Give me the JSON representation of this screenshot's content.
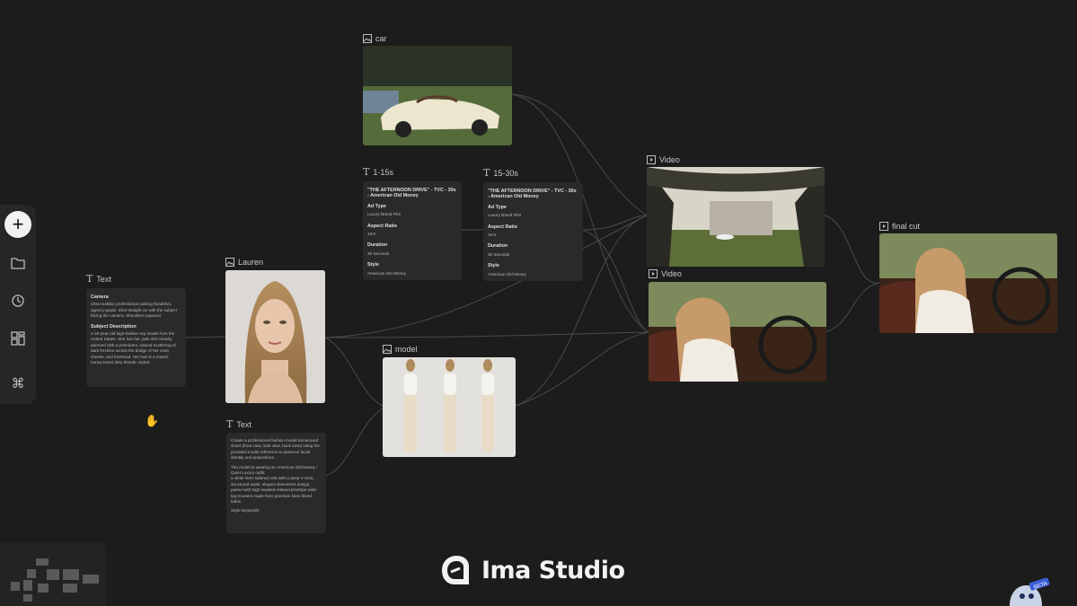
{
  "brand": {
    "name": "Ima Studio"
  },
  "toolbar": {
    "items": [
      {
        "name": "add",
        "icon": "plus-icon"
      },
      {
        "name": "files",
        "icon": "folder-icon"
      },
      {
        "name": "history",
        "icon": "history-icon"
      },
      {
        "name": "templates",
        "icon": "grid-icon"
      },
      {
        "name": "shortcuts",
        "icon": "command-icon"
      }
    ]
  },
  "nodes": {
    "car": {
      "label": "car",
      "icon": "image-icon"
    },
    "lauren": {
      "label": "Lauren",
      "icon": "image-icon"
    },
    "model": {
      "label": "model",
      "icon": "image-icon"
    },
    "video1": {
      "label": "Video",
      "icon": "video-icon"
    },
    "video2": {
      "label": "Video",
      "icon": "video-icon"
    },
    "final": {
      "label": "final cut",
      "icon": "video-icon"
    },
    "text1": {
      "label": "Text",
      "h1": "Camera",
      "p1": "Ultra-realistic professional casting headshot, agency-grade. Shot straight-on with the subject facing the camera. Shoulders squared.",
      "h2": "Subject Description",
      "p2": "A 20-year-old high-fashion top model from the United States. She has fair, pale skin heavily adorned with a prominent, natural scattering of dark freckles across the bridge of her nose, cheeks, and forehead. Her hair is a muted, honey-toned dirty blonde, styled"
    },
    "text2": {
      "label": "Text",
      "p1": "Create a professional fashion model turnaround sheet (front view, side view, back view) using the provided model reference to preserve facial identity and proportions.",
      "p2": "The model is wearing an American Old Money / Quiet Luxury outfit:",
      "p3": "a white linen tailored vest with a deep V-neck, structured waist, elegant sleeveless design, paired with high-waisted relaxed pinstripe wide-leg trousers made from premium linen blend fabric.",
      "p4": "Style keywords:"
    },
    "script1": {
      "label": "1-15s",
      "title": "\"THE AFTERNOON DRIVE\" - TVC - 30s - American Old Money",
      "k1": "Ad Type",
      "v1": "Luxury Brand Film",
      "k2": "Aspect Ratio",
      "v2": "16:9",
      "k3": "Duration",
      "v3": "30 Seconds",
      "k4": "Style",
      "v4": "American Old Money"
    },
    "script2": {
      "label": "15-30s",
      "title": "\"THE AFTERNOON DRIVE\" - TVC - 30s - American Old Money",
      "k1": "Ad Type",
      "v1": "Luxury Brand Film",
      "k2": "Aspect Ratio",
      "v2": "16:9",
      "k3": "Duration",
      "v3": "30 Seconds",
      "k4": "Style",
      "v4": "American Old Money"
    }
  },
  "badge": {
    "beta": "BETA"
  }
}
